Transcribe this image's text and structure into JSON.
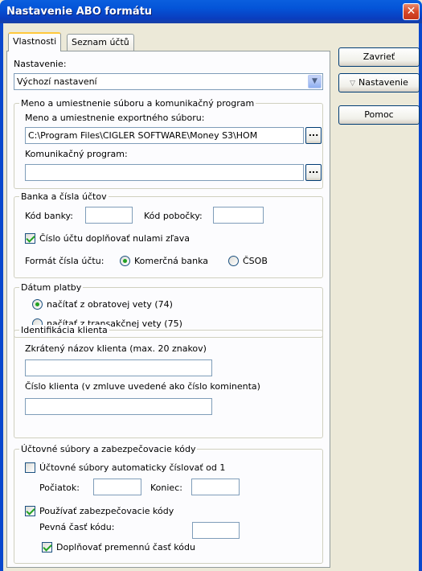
{
  "window": {
    "title": "Nastavenie ABO formátu",
    "close_label": "✕"
  },
  "tabs": [
    "Vlastnosti",
    "Seznam účtů"
  ],
  "buttons": {
    "close": "Zavrieť",
    "settings": "Nastavenie",
    "help": "Pomoc",
    "browse": "..."
  },
  "nastavenie": {
    "label": "Nastavenie:",
    "selected": "Výchozí nastavení"
  },
  "file_group": {
    "title": "Meno a umiestnenie súboru a komunikačný program",
    "export_label": "Meno a umiestnenie exportného súboru:",
    "export_value": "C:\\Program Files\\CIGLER SOFTWARE\\Money S3\\HOM",
    "program_label": "Komunikačný program:",
    "program_value": ""
  },
  "bank_group": {
    "title": "Banka a čísla účtov",
    "bank_code_label": "Kód banky:",
    "branch_code_label": "Kód pobočky:",
    "pad_zeros_label": "Číslo účtu doplňovať nulami zľava",
    "format_label": "Formát čísla účtu:",
    "format_opt1": "Komerčná banka",
    "format_opt2": "ČSOB"
  },
  "date_group": {
    "title": "Dátum platby",
    "opt1": "načítať z obratovej vety (74)",
    "opt2": "načítať z transakčnej vety (75)"
  },
  "client_group": {
    "title": "Identifikácia klienta",
    "short_name_label": "Zkrátený názov klienta (max. 20 znakov)",
    "client_no_label": "Číslo klienta (v zmluve uvedené ako číslo kominenta)"
  },
  "acc_group": {
    "title": "Účtovné súbory a zabezpečovacie kódy",
    "auto_number_label": "Účtovné súbory automaticky číslovať od 1",
    "start_label": "Počiatok:",
    "end_label": "Koniec:",
    "use_codes_label": "Používať zabezpečovacie kódy",
    "fixed_part_label": "Pevná časť kódu:",
    "fill_variable_label": "Doplňovať premennú časť kódu"
  },
  "colors": {
    "title_bar": "#0454d8",
    "panel_bg": "#fcfcfe",
    "window_bg": "#ece9d8",
    "check_green": "#21a121"
  }
}
